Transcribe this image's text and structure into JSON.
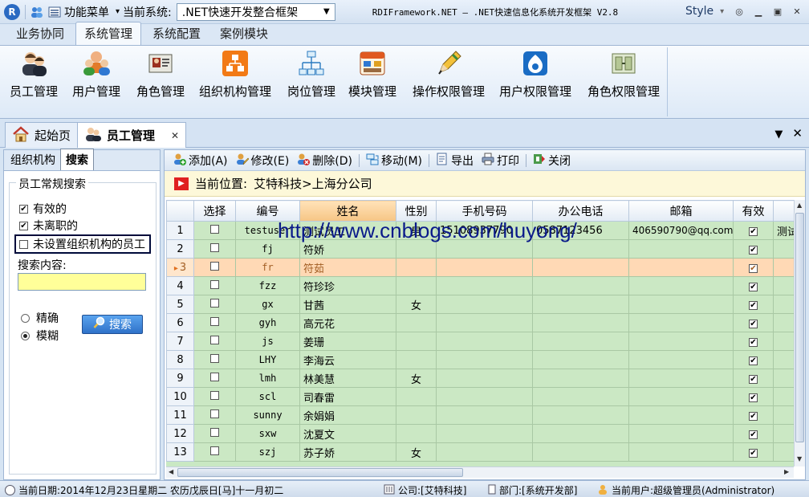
{
  "titlebar": {
    "function_menu": "功能菜单",
    "current_system_label": "当前系统:",
    "current_system_value": ".NET快速开发整合框架",
    "window_title": "RDIFramework.NET  —  .NET快速信息化系统开发框架 V2.8",
    "style_label": "Style"
  },
  "ribbon_tabs": [
    "业务协同",
    "系统管理",
    "系统配置",
    "案例模块"
  ],
  "ribbon_buttons": [
    {
      "label": "员工管理",
      "icon": "staff-icon"
    },
    {
      "label": "用户管理",
      "icon": "users-icon"
    },
    {
      "label": "角色管理",
      "icon": "role-card-icon"
    },
    {
      "label": "组织机构管理",
      "icon": "org-icon"
    },
    {
      "label": "岗位管理",
      "icon": "hierarchy-icon"
    },
    {
      "label": "模块管理",
      "icon": "module-icon"
    },
    {
      "label": "操作权限管理",
      "icon": "pencil-icon"
    },
    {
      "label": "用户权限管理",
      "icon": "drupal-icon"
    },
    {
      "label": "角色权限管理",
      "icon": "gate-icon"
    }
  ],
  "doc_tabs": [
    {
      "label": "起始页",
      "icon": "home-icon"
    },
    {
      "label": "员工管理",
      "icon": "staff-icon"
    }
  ],
  "left_panel": {
    "tabs": [
      "组织机构",
      "搜索"
    ],
    "fieldset_title": "员工常规搜索",
    "checkboxes": [
      {
        "label": "有效的",
        "checked": true
      },
      {
        "label": "未离职的",
        "checked": true
      },
      {
        "label": "未设置组织机构的员工",
        "checked": false
      }
    ],
    "search_label": "搜索内容:",
    "search_value": "",
    "radios": [
      {
        "label": "精确",
        "checked": false
      },
      {
        "label": "模糊",
        "checked": true
      }
    ],
    "search_button": "搜索"
  },
  "toolbar": [
    {
      "label": "添加(A)",
      "icon": "add-icon"
    },
    {
      "label": "修改(E)",
      "icon": "edit-icon"
    },
    {
      "label": "删除(D)",
      "icon": "delete-icon"
    },
    {
      "label": "移动(M)",
      "icon": "move-icon"
    },
    {
      "label": "导出",
      "icon": "export-icon"
    },
    {
      "label": "打印",
      "icon": "print-icon"
    },
    {
      "label": "关闭",
      "icon": "close-icon"
    }
  ],
  "location": {
    "label": "当前位置:",
    "path": "艾特科技>上海分公司"
  },
  "grid": {
    "columns": [
      "选择",
      "编号",
      "姓名",
      "性别",
      "手机号码",
      "办公电话",
      "邮箱",
      "有效",
      ""
    ],
    "rows": [
      {
        "n": "1",
        "code": "testuser",
        "name": "测试员工",
        "gender": "男",
        "mobile": "15108937790",
        "phone": "0587123456",
        "email": "406590790@qq.com",
        "valid": true,
        "extra": "测试"
      },
      {
        "n": "2",
        "code": "fj",
        "name": "符娇",
        "gender": "",
        "mobile": "",
        "phone": "",
        "email": "",
        "valid": true,
        "extra": ""
      },
      {
        "n": "3",
        "code": "fr",
        "name": "符茹",
        "gender": "",
        "mobile": "",
        "phone": "",
        "email": "",
        "valid": true,
        "extra": ""
      },
      {
        "n": "4",
        "code": "fzz",
        "name": "符珍珍",
        "gender": "",
        "mobile": "",
        "phone": "",
        "email": "",
        "valid": true,
        "extra": ""
      },
      {
        "n": "5",
        "code": "gx",
        "name": "甘茜",
        "gender": "女",
        "mobile": "",
        "phone": "",
        "email": "",
        "valid": true,
        "extra": ""
      },
      {
        "n": "6",
        "code": "gyh",
        "name": "高元花",
        "gender": "",
        "mobile": "",
        "phone": "",
        "email": "",
        "valid": true,
        "extra": ""
      },
      {
        "n": "7",
        "code": "js",
        "name": "姜珊",
        "gender": "",
        "mobile": "",
        "phone": "",
        "email": "",
        "valid": true,
        "extra": ""
      },
      {
        "n": "8",
        "code": "LHY",
        "name": "李海云",
        "gender": "",
        "mobile": "",
        "phone": "",
        "email": "",
        "valid": true,
        "extra": ""
      },
      {
        "n": "9",
        "code": "lmh",
        "name": "林美慧",
        "gender": "女",
        "mobile": "",
        "phone": "",
        "email": "",
        "valid": true,
        "extra": ""
      },
      {
        "n": "10",
        "code": "scl",
        "name": "司春雷",
        "gender": "",
        "mobile": "",
        "phone": "",
        "email": "",
        "valid": true,
        "extra": ""
      },
      {
        "n": "11",
        "code": "sunny",
        "name": "余娟娟",
        "gender": "",
        "mobile": "",
        "phone": "",
        "email": "",
        "valid": true,
        "extra": ""
      },
      {
        "n": "12",
        "code": "sxw",
        "name": "沈夏文",
        "gender": "",
        "mobile": "",
        "phone": "",
        "email": "",
        "valid": true,
        "extra": ""
      },
      {
        "n": "13",
        "code": "szj",
        "name": "苏子娇",
        "gender": "女",
        "mobile": "",
        "phone": "",
        "email": "",
        "valid": true,
        "extra": ""
      }
    ],
    "selected_row": 2
  },
  "watermark": "http://www.cnblogs.com/huyong/",
  "statusbar": {
    "date": "当前日期:2014年12月23日星期二 农历戊辰日[马]十一月初二",
    "company": "公司:[艾特科技]",
    "department": "部门:[系统开发部]",
    "user": "当前用户:超级管理员(Administrator)"
  }
}
